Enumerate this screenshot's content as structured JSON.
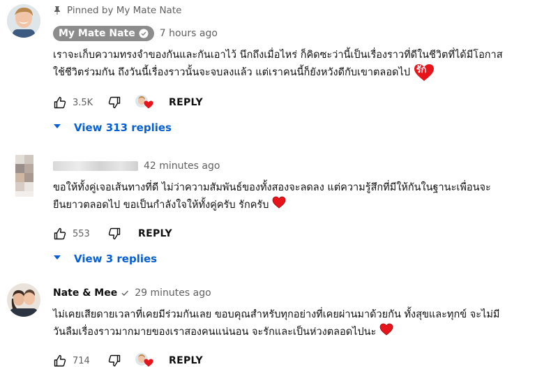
{
  "comments": [
    {
      "pinned_label": "Pinned by My Mate Nate",
      "author": "My Mate Nate",
      "time": "7 hours ago",
      "text_line1": "เราจะเก็บความทรงจำของกันและกันเอาไว้ นึกถึงเมื่อไหร่ ก็คิดซะว่านี้เป็นเรื่องราวที่ดีในชีวิตที่ได้มีโอกาส",
      "text_line2": "ใช้ชีวิตร่วมกัน ถึงวันนี้เรื่องราวนั้นจะจบลงแล้ว แต่เราคนนี้ก็ยังหวังดีกับเขาตลอดไป",
      "emoji_text": "รัก",
      "likes": "3.5K",
      "reply_label": "REPLY",
      "view_replies": "View 313 replies"
    },
    {
      "time": "42 minutes ago",
      "text_line1": "ขอให้ทั้งคู่เจอเส้นทางที่ดี ไม่ว่าความสัมพันธ์ของทั้งสองจะลดลง แต่ความรู้สึกที่มีให้กันในฐานะเพื่อนจะ",
      "text_line2": "ยืนยาวตลอดไป ขอเป็นกำลังใจให้ทั้งคู่ครับ รักครับ",
      "likes": "553",
      "reply_label": "REPLY",
      "view_replies": "View 3 replies"
    },
    {
      "author": "Nate & Mee",
      "time": "29 minutes ago",
      "text_line1": "ไม่เคยเสียดายเวลาที่เคยมีร่วมกันเลย ขอบคุณสำหรับทุกอย่างที่เคยผ่านมาด้วยกัน ทั้งสุขและทุกข์ จะไม่มี",
      "text_line2": "วันลืมเรื่องราวมากมายของเราสองคนแน่นอน จะรักและเป็นห่วงตลอดไปนะ",
      "likes": "714",
      "reply_label": "REPLY"
    }
  ],
  "colors": {
    "link": "#065fd4",
    "heart": "#e8141c",
    "chip": "#8c8c8c",
    "muted": "#606060"
  },
  "icons": [
    "pin-icon",
    "verified-icon",
    "like-icon",
    "dislike-icon",
    "heart-icon",
    "chevron-down-icon"
  ]
}
